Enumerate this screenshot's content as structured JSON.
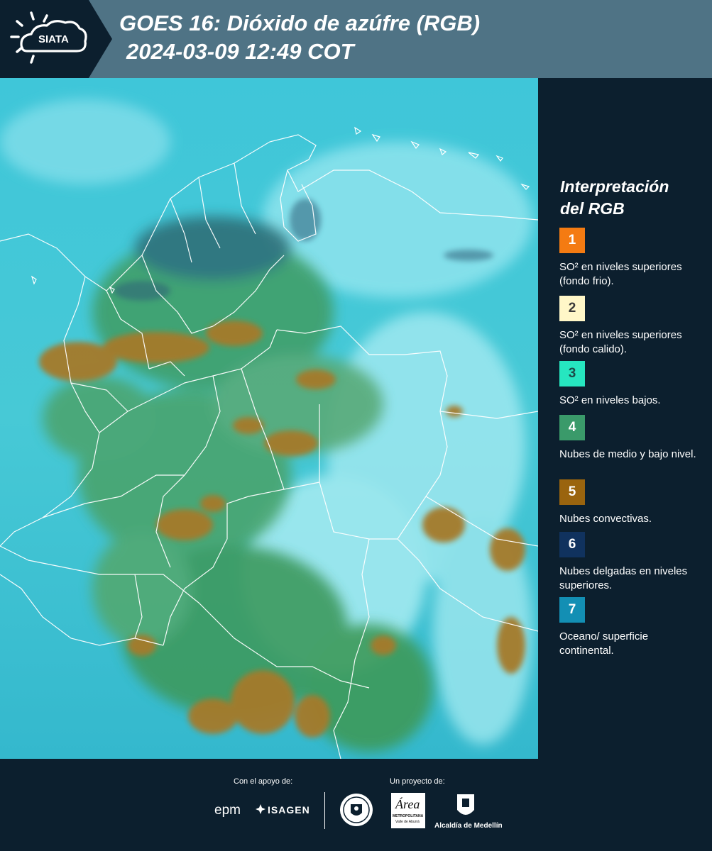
{
  "header": {
    "logo_text": "SIATA",
    "title": "GOES 16: Dióxido de azúfre (RGB)",
    "datetime": "2024-03-09 12:49 COT"
  },
  "legend": {
    "title_line1": "Interpretación",
    "title_line2": "del RGB",
    "items": [
      {
        "number": "1",
        "color": "#f47b12",
        "number_color": "#ffffff",
        "text": "SO² en niveles superiores (fondo frio)."
      },
      {
        "number": "2",
        "color": "#fff7c8",
        "number_color": "#3a3a3a",
        "text": "SO² en niveles superiores (fondo calido)."
      },
      {
        "number": "3",
        "color": "#26e6c0",
        "number_color": "#1d4a48",
        "text": "SO² en niveles bajos."
      },
      {
        "number": "4",
        "color": "#3a9a6a",
        "number_color": "#ffffff",
        "text": "Nubes de medio y bajo nivel."
      },
      {
        "number": "5",
        "color": "#9a640e",
        "number_color": "#ffffff",
        "text": "Nubes convectivas."
      },
      {
        "number": "6",
        "color": "#10325e",
        "number_color": "#ffffff",
        "text": "Nubes delgadas en niveles superiores."
      },
      {
        "number": "7",
        "color": "#138fb4",
        "number_color": "#ffffff",
        "text": "Oceano/ superficie continental."
      }
    ]
  },
  "footer": {
    "support_label": "Con el apoyo de:",
    "project_label": "Un proyecto de:",
    "sponsor1": "epm",
    "sponsor2": "ISAGEN",
    "area_top": "Área",
    "area_line1": "METROPOLITANA",
    "area_line2": "Valle de Aburrá",
    "alcaldia": "Alcaldía de Medellín"
  }
}
